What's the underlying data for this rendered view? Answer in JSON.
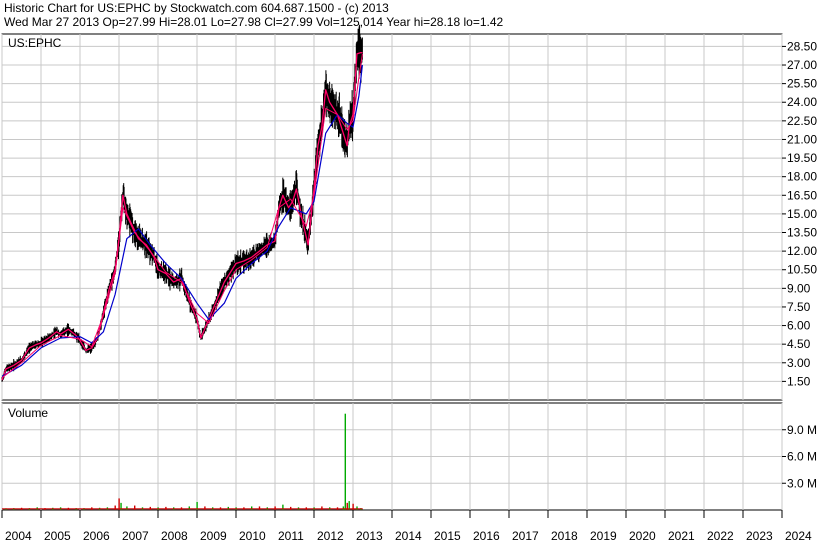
{
  "header": {
    "line1": "Historic Chart for US:EPHC by Stockwatch.com 604.687.1500 - (c) 2013",
    "line2": "Wed Mar 27 2013   Op=27.99  Hi=28.01  Lo=27.98  Cl=27.99  Vol=125,014   Year hi=28.18  lo=1.42"
  },
  "colors": {
    "price_bar": "#000000",
    "ma_short": "#ff0066",
    "ma_long": "#0000cc",
    "volume_up": "#00aa00",
    "volume_down": "#cc0000",
    "grid": "#c8c8c8"
  },
  "chart_data": [
    {
      "type": "line",
      "series_label": "US:EPHC",
      "x_ticks": [
        "2004",
        "2005",
        "2006",
        "2007",
        "2008",
        "2009",
        "2010",
        "2011",
        "2012",
        "2013",
        "2014",
        "2015",
        "2016",
        "2017",
        "2018",
        "2019",
        "2020",
        "2021",
        "2022",
        "2023",
        "2024"
      ],
      "y_ticks": [
        1.5,
        3.0,
        4.5,
        6.0,
        7.5,
        9.0,
        10.5,
        12.0,
        13.5,
        15.0,
        16.5,
        18.0,
        19.5,
        21.0,
        22.5,
        24.0,
        25.5,
        27.0,
        28.5
      ],
      "y_tick_labels": [
        "1.50",
        "3.00",
        "4.50",
        "6.00",
        "7.50",
        "9.00",
        "10.50",
        "12.00",
        "13.50",
        "15.00",
        "16.50",
        "18.00",
        "19.50",
        "21.00",
        "22.50",
        "24.00",
        "25.50",
        "27.00",
        "28.50"
      ],
      "ylim": [
        0,
        29.5
      ],
      "xlim": [
        2004.0,
        2024.0
      ],
      "grid": true,
      "series": [
        {
          "role": "price",
          "x": [
            2004.0,
            2004.1,
            2004.3,
            2004.5,
            2004.7,
            2004.9,
            2005.0,
            2005.2,
            2005.4,
            2005.5,
            2005.7,
            2005.9,
            2006.0,
            2006.15,
            2006.3,
            2006.45,
            2006.6,
            2006.75,
            2006.9,
            2007.0,
            2007.1,
            2007.2,
            2007.35,
            2007.5,
            2007.7,
            2007.9,
            2008.0,
            2008.2,
            2008.4,
            2008.6,
            2008.8,
            2009.0,
            2009.1,
            2009.3,
            2009.5,
            2009.7,
            2009.9,
            2010.0,
            2010.2,
            2010.4,
            2010.6,
            2010.8,
            2011.0,
            2011.1,
            2011.2,
            2011.35,
            2011.45,
            2011.55,
            2011.7,
            2011.85,
            2012.0,
            2012.1,
            2012.2,
            2012.3,
            2012.4,
            2012.5,
            2012.6,
            2012.75,
            2012.85,
            2012.9,
            2013.0,
            2013.1,
            2013.2,
            2013.24
          ],
          "y": [
            1.6,
            2.5,
            2.8,
            3.2,
            4.2,
            4.5,
            4.6,
            5.0,
            5.5,
            5.3,
            5.7,
            5.2,
            4.8,
            4.0,
            4.2,
            5.0,
            7.0,
            9.0,
            10.5,
            13.0,
            16.5,
            15.0,
            14.0,
            13.0,
            12.5,
            11.5,
            10.5,
            10.2,
            9.5,
            9.8,
            8.0,
            6.5,
            5.0,
            6.5,
            8.0,
            9.5,
            10.5,
            11.0,
            11.2,
            11.5,
            12.0,
            12.5,
            12.8,
            15.5,
            16.5,
            15.5,
            16.0,
            17.0,
            14.5,
            12.5,
            17.0,
            20.5,
            22.0,
            25.0,
            24.0,
            23.5,
            23.0,
            21.5,
            20.5,
            22.0,
            23.0,
            27.9,
            28.0,
            27.99
          ]
        },
        {
          "role": "moving-average-short",
          "x": [
            2004.0,
            2004.5,
            2005.0,
            2005.5,
            2006.0,
            2006.3,
            2006.6,
            2006.9,
            2007.1,
            2007.4,
            2007.8,
            2008.2,
            2008.6,
            2009.0,
            2009.3,
            2009.7,
            2010.0,
            2010.4,
            2010.8,
            2011.1,
            2011.4,
            2011.8,
            2012.0,
            2012.3,
            2012.6,
            2012.85,
            2013.0,
            2013.15,
            2013.24
          ],
          "y": [
            1.8,
            3.0,
            4.4,
            5.2,
            4.9,
            4.3,
            6.8,
            10.2,
            15.5,
            13.5,
            12.0,
            10.3,
            9.5,
            7.0,
            6.2,
            8.8,
            10.5,
            11.3,
            12.3,
            15.5,
            16.2,
            14.0,
            16.5,
            23.5,
            23.0,
            21.8,
            22.5,
            26.0,
            27.9
          ]
        },
        {
          "role": "moving-average-long",
          "x": [
            2004.0,
            2004.5,
            2005.0,
            2005.5,
            2006.0,
            2006.3,
            2006.6,
            2006.9,
            2007.2,
            2007.5,
            2007.8,
            2008.2,
            2008.6,
            2009.0,
            2009.3,
            2009.7,
            2010.0,
            2010.4,
            2010.8,
            2011.1,
            2011.4,
            2011.8,
            2012.0,
            2012.3,
            2012.6,
            2012.85,
            2013.0,
            2013.15,
            2013.24
          ],
          "y": [
            1.9,
            2.8,
            4.2,
            5.0,
            5.1,
            4.6,
            5.5,
            8.5,
            13.0,
            13.8,
            12.5,
            11.0,
            9.8,
            7.8,
            6.5,
            7.8,
            9.8,
            11.0,
            12.0,
            14.0,
            15.5,
            15.0,
            16.0,
            21.5,
            23.0,
            22.3,
            22.0,
            24.5,
            27.0
          ]
        }
      ]
    },
    {
      "type": "bar",
      "title": "Volume",
      "y_ticks": [
        3.0,
        6.0,
        9.0
      ],
      "y_tick_labels": [
        "3.0 M",
        "6.0 M",
        "9.0 M"
      ],
      "ylim": [
        0,
        12.0
      ],
      "xlim": [
        2004.0,
        2024.0
      ],
      "grid": true,
      "units": "M",
      "x": [
        2004.1,
        2004.3,
        2004.5,
        2004.7,
        2004.9,
        2005.1,
        2005.3,
        2005.5,
        2005.7,
        2005.9,
        2006.1,
        2006.3,
        2006.5,
        2006.7,
        2006.9,
        2007.0,
        2007.05,
        2007.2,
        2007.4,
        2007.6,
        2007.8,
        2008.0,
        2008.2,
        2008.4,
        2008.6,
        2008.8,
        2009.0,
        2009.2,
        2009.4,
        2009.6,
        2009.8,
        2010.0,
        2010.2,
        2010.4,
        2010.6,
        2010.8,
        2011.0,
        2011.2,
        2011.4,
        2011.6,
        2011.8,
        2012.0,
        2012.2,
        2012.4,
        2012.6,
        2012.75,
        2012.8,
        2012.85,
        2012.9,
        2013.0,
        2013.1,
        2013.2
      ],
      "values": [
        0.15,
        0.2,
        0.25,
        0.2,
        0.3,
        0.2,
        0.25,
        0.3,
        0.25,
        0.2,
        0.2,
        0.3,
        0.25,
        0.3,
        0.5,
        1.3,
        0.8,
        0.4,
        0.5,
        0.3,
        0.35,
        0.3,
        0.35,
        0.3,
        0.3,
        0.4,
        0.9,
        0.4,
        0.3,
        0.3,
        0.35,
        0.3,
        0.3,
        0.4,
        0.4,
        0.3,
        0.4,
        0.6,
        0.35,
        0.3,
        0.3,
        0.3,
        0.4,
        0.3,
        0.3,
        0.4,
        10.8,
        0.8,
        1.0,
        0.7,
        0.4,
        0.2
      ],
      "up": [
        true,
        true,
        false,
        true,
        true,
        false,
        true,
        true,
        false,
        true,
        true,
        false,
        true,
        true,
        false,
        false,
        true,
        true,
        false,
        true,
        false,
        true,
        false,
        true,
        false,
        true,
        true,
        false,
        true,
        false,
        true,
        true,
        false,
        true,
        false,
        true,
        false,
        true,
        false,
        true,
        false,
        true,
        false,
        true,
        false,
        true,
        true,
        false,
        true,
        false,
        true,
        true
      ]
    }
  ]
}
